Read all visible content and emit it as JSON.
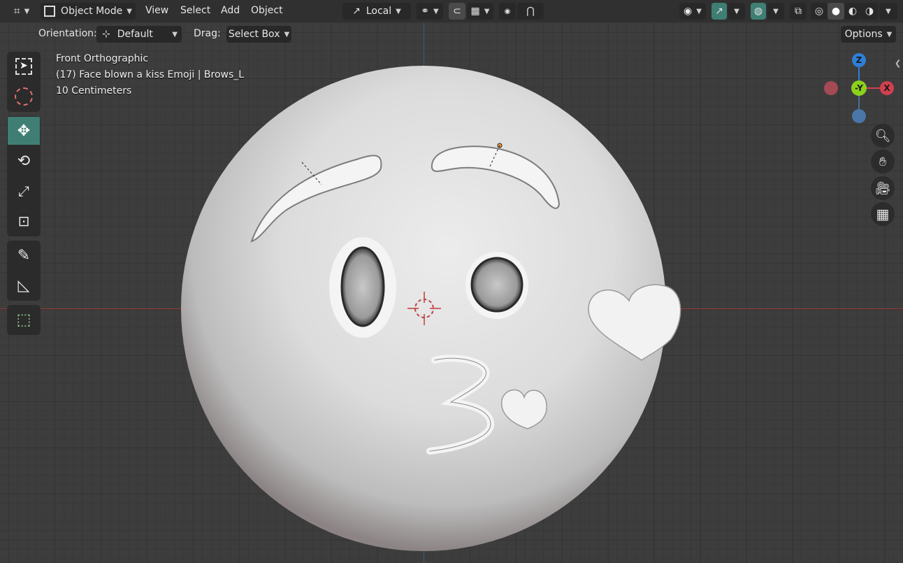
{
  "header": {
    "mode": "Object Mode",
    "menus": [
      "View",
      "Select",
      "Add",
      "Object"
    ],
    "transform_pivot": "Local"
  },
  "tool_settings": {
    "orientation_label": "Orientation:",
    "orientation_value": "Default",
    "drag_label": "Drag:",
    "drag_value": "Select Box",
    "options_label": "Options"
  },
  "viewport_info": {
    "view_name": "Front Orthographic",
    "object_info": "(17) Face blown a kiss Emoji | Brows_L",
    "scale": "10 Centimeters"
  },
  "gizmo": {
    "z_label": "Z",
    "y_label": "-Y",
    "x_label": "X"
  },
  "colors": {
    "accent": "#3f7f73",
    "axis_x": "#d23f4f",
    "axis_y": "#8bd21d",
    "axis_z": "#2e7fd6"
  },
  "icons": [
    "editor-type-icon",
    "object-mode-icon",
    "transform-orientation-icon",
    "pivot-icon",
    "snap-icon",
    "snap-grid-icon",
    "proportional-icon",
    "falloff-icon",
    "visibility-icon",
    "gizmo-icon",
    "overlay-icon",
    "xray-icon",
    "wireframe-shading-icon",
    "solid-shading-icon",
    "material-shading-icon",
    "rendered-shading-icon",
    "select-box-icon",
    "cursor-icon",
    "move-icon",
    "rotate-icon",
    "scale-icon",
    "transform-icon",
    "annotate-icon",
    "measure-icon",
    "add-cube-icon",
    "zoom-icon",
    "pan-hand-icon",
    "camera-icon",
    "grid-icon"
  ]
}
